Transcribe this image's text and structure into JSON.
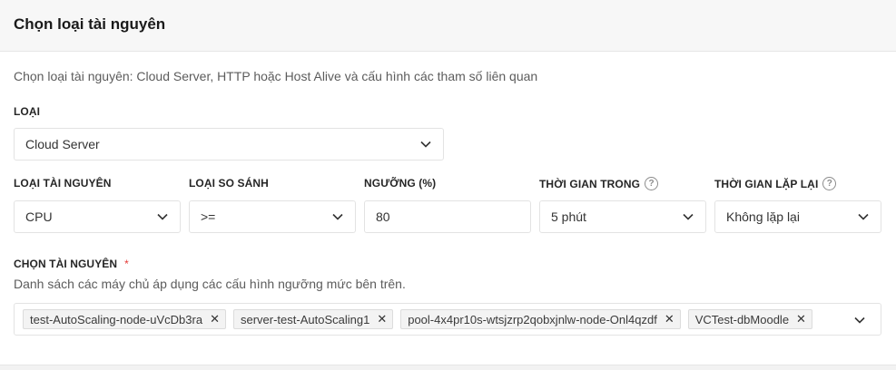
{
  "header": {
    "title": "Chọn loại tài nguyên"
  },
  "description": "Chọn loại tài nguyên: Cloud Server, HTTP hoặc Host Alive và cấu hình các tham số liên quan",
  "type_field": {
    "label": "LOẠI",
    "value": "Cloud Server"
  },
  "resource_type": {
    "label": "LOẠI TÀI NGUYÊN",
    "value": "CPU"
  },
  "comparison": {
    "label": "LOẠI SO SÁNH",
    "value": ">="
  },
  "threshold": {
    "label": "NGƯỠNG (%)",
    "value": "80"
  },
  "duration": {
    "label": "THỜI GIAN TRONG",
    "value": "5 phút",
    "help_icon": "?"
  },
  "repeat": {
    "label": "THỜI GIAN LẶP LẠI",
    "value": "Không lặp lại",
    "help_icon": "?"
  },
  "resources": {
    "label": "CHỌN TÀI NGUYÊN",
    "required_mark": "*",
    "hint": "Danh sách các máy chủ áp dụng các cấu hình ngưỡng mức bên trên.",
    "tags": [
      {
        "name": "test-AutoScaling-node-uVcDb3ra"
      },
      {
        "name": "server-test-AutoScaling1"
      },
      {
        "name": "pool-4x4pr10s-wtsjzrp2qobxjnlw-node-Onl4qzdf"
      },
      {
        "name": "VCTest-dbMoodle"
      }
    ],
    "remove_glyph": "✕"
  },
  "colors": {
    "required": "#e53935",
    "border": "#e3e3e3",
    "header_bg": "#f7f7f7"
  }
}
